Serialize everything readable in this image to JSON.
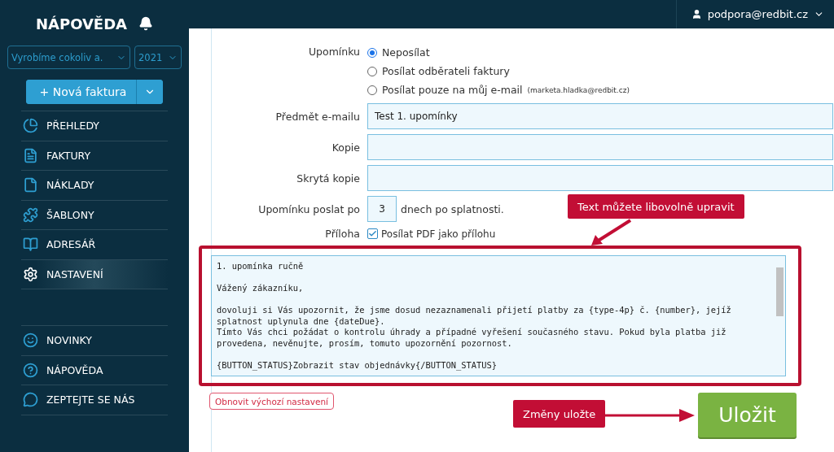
{
  "sidebar": {
    "title": "NÁPOVĚDA",
    "company_select": "Vyrobíme cokoliv a.",
    "year_select": "2021",
    "new_button": "+ Nová faktura",
    "items": [
      {
        "label": "PŘEHLEDY",
        "selected": false
      },
      {
        "label": "FAKTURY",
        "selected": false
      },
      {
        "label": "NÁKLADY",
        "selected": false
      },
      {
        "label": "ŠABLONY",
        "selected": false
      },
      {
        "label": "ADRESÁŘ",
        "selected": false
      },
      {
        "label": "NASTAVENÍ",
        "selected": true
      }
    ],
    "bottom_items": [
      {
        "label": "NOVINKY",
        "selected": false
      },
      {
        "label": "NÁPOVĚDA",
        "selected": false
      },
      {
        "label": "ZEPTEJTE SE NÁS",
        "selected": false
      }
    ]
  },
  "top_bar": {
    "user": "podpora@redbit.cz"
  },
  "form": {
    "reminder_label": "Upomínku",
    "reminder_options": [
      {
        "label": "Neposílat",
        "selected": true
      },
      {
        "label": "Posílat odběrateli faktury",
        "selected": false
      },
      {
        "label": "Posílat pouze na můj e-mail",
        "note": "(marketa.hladka@redbit.cz)",
        "selected": false
      }
    ],
    "subject_label": "Předmět e-mailu",
    "subject_value": "Test 1. upomínky",
    "cc_label": "Kopie",
    "bcc_label": "Skrytá kopie",
    "days_label": "Upomínku poslat po",
    "days_value": "3",
    "days_suffix": "dnech po splatnosti.",
    "attachment_label": "Příloha",
    "attachment_checkbox": {
      "label": "Posílat PDF jako přílohu",
      "checked": true
    },
    "message_paragraphs": [
      [
        "1. upomínka ručně"
      ],
      [
        "Vážený zákazníku,"
      ],
      [
        "dovoluji si Vás upozornit, že jsme dosud nezaznamenali přijetí platby za {type-4p} č. {number}, jejíž",
        "splatnost uplynula dne {dateDue}.",
        "Tímto Vás chci požádat o kontrolu úhrady a případné vyřešení současného stavu. Pokud byla platba již",
        "provedena, nevěnujte, prosím, tomuto upozornění pozornost."
      ],
      [
        "{BUTTON_STATUS}Zobrazit stav objednávky{/BUTTON_STATUS}"
      ]
    ],
    "reset_button": "Obnovit výchozí nastavení",
    "save_button": "Uložit"
  },
  "callouts": [
    {
      "text": "Text můžete libovolně upravit"
    },
    {
      "text": "Změny uložte"
    }
  ]
}
